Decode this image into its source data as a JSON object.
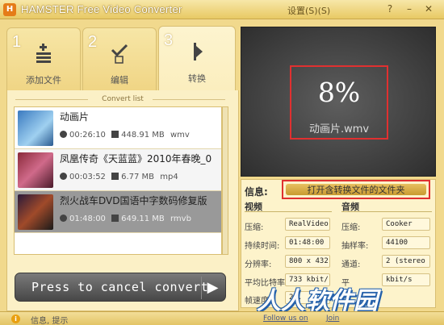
{
  "titlebar": {
    "app_title": "HAMSTER Free Video Converter",
    "settings_label": "设置(S)(S)",
    "help": "?",
    "minimize": "–",
    "close": "✕"
  },
  "tabs": [
    {
      "number": "1",
      "label": "添加文件",
      "icon": "add-list-icon"
    },
    {
      "number": "2",
      "label": "编辑",
      "icon": "edit-check-icon"
    },
    {
      "number": "3",
      "label": "转换",
      "icon": "play-arrow-icon"
    }
  ],
  "convert_list": {
    "title": "Convert list",
    "items": [
      {
        "name": "动画片",
        "duration": "00:26:10",
        "size": "448.91 MB",
        "format": "wmv"
      },
      {
        "name": "凤凰传奇《天蓝蓝》2010年春晚_0",
        "duration": "00:03:52",
        "size": "6.77 MB",
        "format": "mp4"
      },
      {
        "name": "烈火战车DVD国语中字数码修复版",
        "duration": "01:48:00",
        "size": "649.11 MB",
        "format": "rmvb"
      }
    ]
  },
  "cancel_button": {
    "label": "Press to cancel convert"
  },
  "preview": {
    "percent": "8%",
    "filename": "动画片.wmv"
  },
  "info": {
    "label": "信息:",
    "open_folder": "打开含转换文件的文件夹",
    "video": {
      "title": "视频",
      "rows": [
        {
          "k": "压缩:",
          "v": "RealVideo"
        },
        {
          "k": "持续时间:",
          "v": "01:48:00"
        },
        {
          "k": "分辨率:",
          "v": "800 x 432"
        },
        {
          "k": "平均比特率",
          "v": "733 kbit/"
        },
        {
          "k": "帧速度",
          "v": "23."
        }
      ]
    },
    "audio": {
      "title": "音频",
      "rows": [
        {
          "k": "压缩:",
          "v": "Cooker"
        },
        {
          "k": "抽样率:",
          "v": "44100"
        },
        {
          "k": "通道:",
          "v": "2 (stereo"
        },
        {
          "k": "平",
          "v": "kbit/s"
        }
      ]
    }
  },
  "status": {
    "text": "信息, 提示",
    "follow": "Follow us on",
    "join": "Join"
  },
  "watermark": "人人软件园"
}
